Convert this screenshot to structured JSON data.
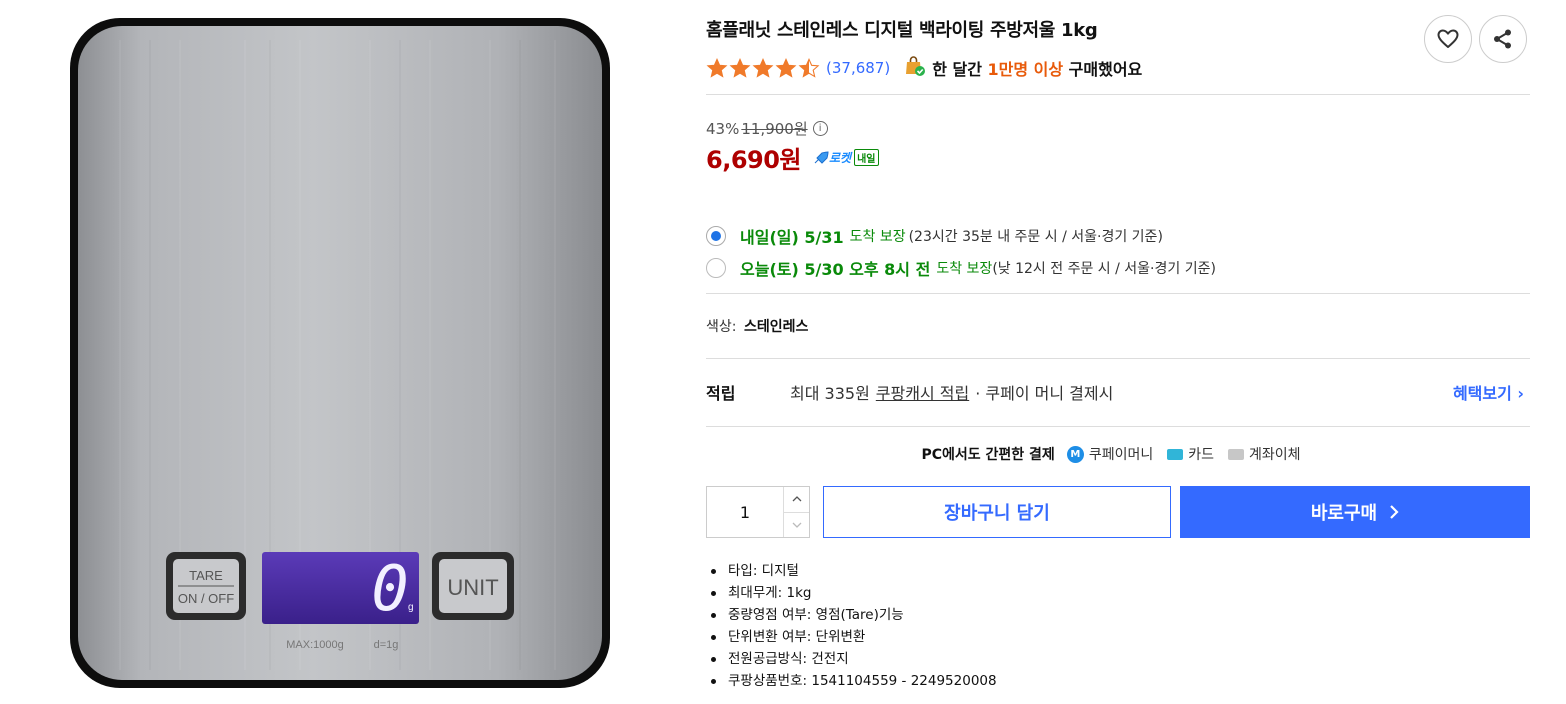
{
  "product": {
    "title": "홈플래닛 스테인레스 디지털 백라이팅 주방저울 1kg",
    "rating": 4.5,
    "review_count": "(37,687)",
    "bought_prefix": "한 달간 ",
    "bought_highlight": "1만명 이상",
    "bought_suffix": " 구매했어요"
  },
  "scale_image": {
    "tare_top": "TARE",
    "tare_bottom": "ON / OFF",
    "display_value": "0",
    "display_unit": "g",
    "unit_button": "UNIT",
    "spec_text": "MAX:1000g",
    "division_text": "d=1g"
  },
  "price": {
    "discount": "43%",
    "original": "11,900원",
    "info_icon": "i",
    "sale": "6,690원",
    "rocket_label": "로켓",
    "rocket_tomorrow": "내일"
  },
  "delivery": {
    "options": [
      {
        "date": "내일(일) 5/31",
        "guarantee": "도착 보장",
        "note": "(23시간 35분 내 주문 시 / 서울·경기 기준)",
        "selected": true
      },
      {
        "date": "오늘(토) 5/30 오후 8시 전",
        "guarantee": "도착 보장",
        "note": "(낮 12시 전 주문 시 / 서울·경기 기준)",
        "selected": false
      }
    ]
  },
  "option": {
    "label": "색상:",
    "value": "스테인레스"
  },
  "reward": {
    "label": "적립",
    "prefix": "최대 335원",
    "cash": "쿠팡캐시 적립",
    "suffix": "· 쿠페이 머니 결제시",
    "more": "혜택보기"
  },
  "easypay": {
    "label": "PC에서도 간편한 결제",
    "methods": [
      "쿠페이머니",
      "카드",
      "계좌이체"
    ]
  },
  "purchase": {
    "quantity": "1",
    "cart": "장바구니 담기",
    "buy": "바로구매"
  },
  "specs": [
    "타입: 디지털",
    "최대무게: 1kg",
    "중량영점 여부: 영점(Tare)기능",
    "단위변환 여부: 단위변환",
    "전원공급방식: 건전지",
    "쿠팡상품번호: 1541104559 - 2249520008"
  ],
  "colors": {
    "accent": "#346aff",
    "price": "#ae0000",
    "delivery": "#0a8a0a",
    "star": "#f07a2a",
    "highlight": "#e85a0a"
  }
}
